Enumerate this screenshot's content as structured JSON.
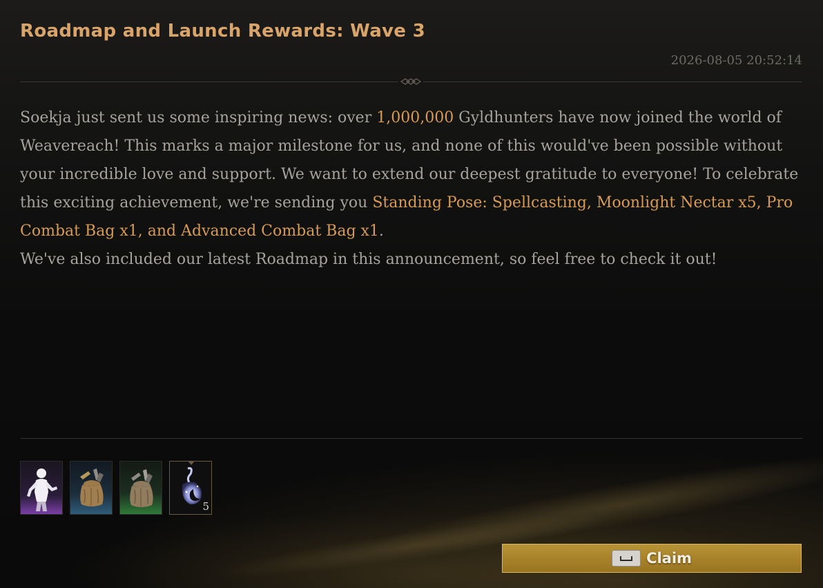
{
  "mail": {
    "title": "Roadmap and Launch Rewards: Wave 3",
    "timestamp": "2026-08-05 20:52:14",
    "body": {
      "p1_a": "Soekja just sent us some inspiring news: over ",
      "p1_highlight": "1,000,000",
      "p1_b": " Gyldhunters have now joined the world of Weavereach! This marks a major milestone for us, and none of this would've been possible without your incredible love and support. We want to extend our deepest gratitude to everyone! To celebrate this exciting achievement, we're sending you ",
      "p1_rewards": "Standing Pose: Spellcasting, Moonlight Nectar x5, Pro Combat Bag x1, and Advanced Combat Bag x1",
      "p1_end": ".",
      "p2": "We've also included our latest Roadmap in this announcement, so feel free to check it out!"
    },
    "accent_color": "#d79a55"
  },
  "rewards": [
    {
      "icon": "standing-pose-icon",
      "count": ""
    },
    {
      "icon": "pro-combat-bag-icon",
      "count": ""
    },
    {
      "icon": "advanced-combat-bag-icon",
      "count": ""
    },
    {
      "icon": "moonlight-nectar-icon",
      "count": "5"
    }
  ],
  "claim": {
    "key_icon": "spacebar-key-icon",
    "label": "Claim",
    "color": "#b08a30"
  }
}
